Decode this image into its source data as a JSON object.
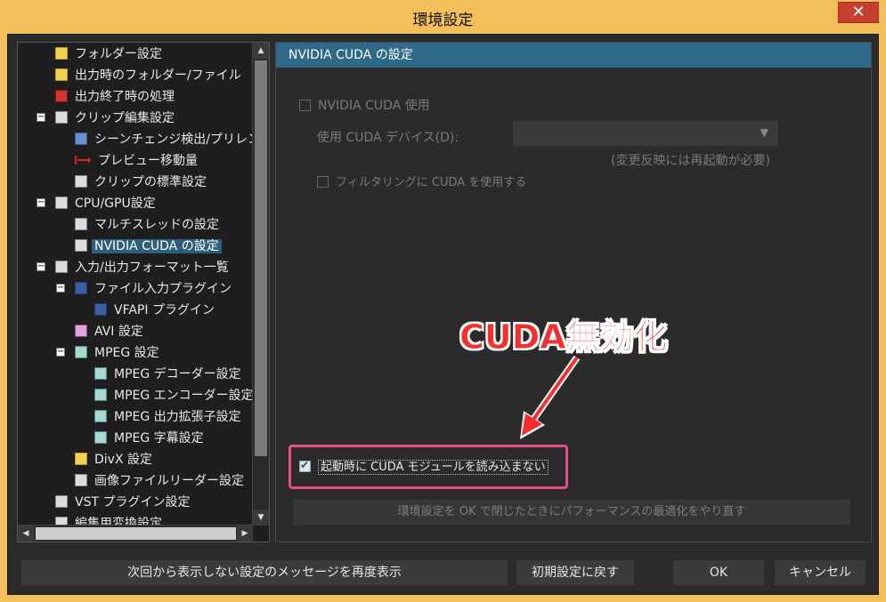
{
  "window": {
    "title": "環境設定",
    "close_glyph": "✕"
  },
  "tree": {
    "items": [
      {
        "label": "フォルダー設定"
      },
      {
        "label": "出力時のフォルダー/ファイル"
      },
      {
        "label": "出力終了時の処理"
      },
      {
        "label": "クリップ編集設定"
      },
      {
        "label": "シーンチェンジ検出/プリレンダリン"
      },
      {
        "label": "プレビュー移動量"
      },
      {
        "label": "クリップの標準設定"
      },
      {
        "label": "CPU/GPU設定"
      },
      {
        "label": "マルチスレッドの設定"
      },
      {
        "label": "NVIDIA CUDA の設定"
      },
      {
        "label": "入力/出力フォーマット一覧"
      },
      {
        "label": "ファイル入力プラグイン"
      },
      {
        "label": "VFAPI プラグイン"
      },
      {
        "label": "AVI 設定"
      },
      {
        "label": "MPEG 設定"
      },
      {
        "label": "MPEG デコーダー設定"
      },
      {
        "label": "MPEG エンコーダー設定"
      },
      {
        "label": "MPEG 出力拡張子設定"
      },
      {
        "label": "MPEG 字幕設定"
      },
      {
        "label": "DivX 設定"
      },
      {
        "label": "画像ファイルリーダー設定"
      },
      {
        "label": "VST プラグイン設定"
      },
      {
        "label": "編集用変換設定"
      }
    ],
    "selected": "NVIDIA CUDA の設定",
    "expander_minus": "−"
  },
  "panel": {
    "header": "NVIDIA CUDA の設定",
    "use_cuda_label": "NVIDIA CUDA 使用",
    "device_label": "使用 CUDA デバイス(D):",
    "device_arrow": "▼",
    "restart_note": "(変更反映には再起動が必要)",
    "filtering_label": "フィルタリングに CUDA を使用する",
    "no_load_label": "起動時に CUDA モジュールを読み込まない",
    "optimize_button": "環境設定を OK で閉じたときにパフォーマンスの最適化をやり直す"
  },
  "annotation": {
    "text": "CUDA無効化",
    "color": "#ff2a2a",
    "box_color": "#e64c86"
  },
  "buttons": {
    "redisplay": "次回から表示しない設定のメッセージを再度表示",
    "reset": "初期設定に戻す",
    "ok": "OK",
    "cancel": "キャンセル"
  },
  "scroll": {
    "up": "▲",
    "down": "▼",
    "left": "◀",
    "right": "▶"
  }
}
